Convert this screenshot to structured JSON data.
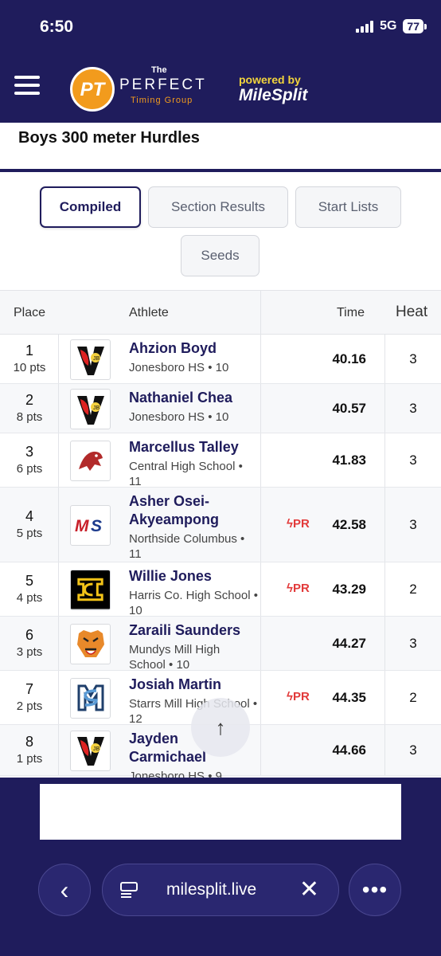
{
  "status": {
    "time": "6:50",
    "network": "5G",
    "battery": "77"
  },
  "header": {
    "logo_the": "The",
    "logo_pt": "PT",
    "logo_perfect": "PERFECT",
    "logo_group": "Timing Group",
    "powered_by": "powered by",
    "milesplit": "MileSplit"
  },
  "event": {
    "title": "Boys 300 meter Hurdles"
  },
  "tabs": [
    {
      "label": "Compiled",
      "active": true
    },
    {
      "label": "Section Results",
      "active": false
    },
    {
      "label": "Start Lists",
      "active": false
    },
    {
      "label": "Seeds",
      "active": false
    }
  ],
  "table": {
    "headers": {
      "place": "Place",
      "athlete": "Athlete",
      "time": "Time",
      "heat": "Heat"
    },
    "rows": [
      {
        "place": "1",
        "pts": "10 pts",
        "name": "Ahzion Boyd",
        "team": "Jonesboro HS • 10",
        "pr": "",
        "time": "40.16",
        "heat": "3",
        "logo": "cardinal-logo"
      },
      {
        "place": "2",
        "pts": "8 pts",
        "name": "Nathaniel Chea",
        "team": "Jonesboro HS • 10",
        "pr": "",
        "time": "40.57",
        "heat": "3",
        "logo": "cardinal-logo"
      },
      {
        "place": "3",
        "pts": "6 pts",
        "name": "Marcellus Talley",
        "team": "Central High School • 11",
        "pr": "",
        "time": "41.83",
        "heat": "3",
        "logo": "lion-logo"
      },
      {
        "place": "4",
        "pts": "5 pts",
        "name": "Asher Osei-Akyeampong",
        "team": "Northside Columbus • 11",
        "pr": "PR",
        "time": "42.58",
        "heat": "3",
        "logo": "ms-logo"
      },
      {
        "place": "5",
        "pts": "4 pts",
        "name": "Willie Jones",
        "team": "Harris Co. High School • 10",
        "pr": "PR",
        "time": "43.29",
        "heat": "2",
        "logo": "hc-logo"
      },
      {
        "place": "6",
        "pts": "3 pts",
        "name": "Zaraili Saunders",
        "team": "Mundys Mill High School • 10",
        "pr": "",
        "time": "44.27",
        "heat": "3",
        "logo": "tiger-logo"
      },
      {
        "place": "7",
        "pts": "2 pts",
        "name": "Josiah Martin",
        "team": "Starrs Mill High School • 12",
        "pr": "PR",
        "time": "44.35",
        "heat": "2",
        "logo": "sm-logo"
      },
      {
        "place": "8",
        "pts": "1 pts",
        "name": "Jayden Carmichael",
        "team": "Jonesboro HS • 9",
        "pr": "",
        "time": "44.66",
        "heat": "3",
        "logo": "cardinal-logo"
      }
    ]
  },
  "browser": {
    "url": "milesplit.live"
  },
  "colors": {
    "navy": "#1f1c5c",
    "accent_orange": "#f29b1d",
    "pr_red": "#e23a3a"
  }
}
